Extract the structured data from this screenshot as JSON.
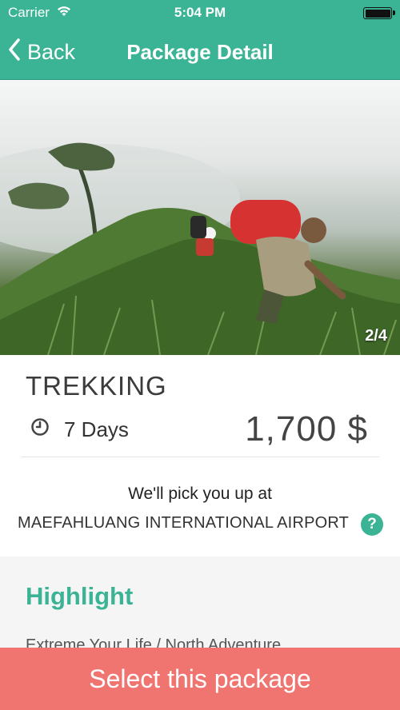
{
  "status_bar": {
    "carrier": "Carrier",
    "time": "5:04 PM"
  },
  "nav": {
    "back_label": "Back",
    "title": "Package Detail"
  },
  "hero": {
    "page_indicator": "2/4"
  },
  "package": {
    "name": "TREKKING",
    "duration": "7 Days",
    "price": "1,700 $",
    "pickup_label": "We'll pick you up at",
    "pickup_location": "MAEFAHLUANG INTERNATIONAL AIRPORT",
    "help_symbol": "?"
  },
  "highlight": {
    "title": "Highlight",
    "text": "Extreme Your Life / North Adventure"
  },
  "cta": {
    "label": "Select this package"
  },
  "colors": {
    "primary": "#3bb395",
    "cta": "#f07570"
  }
}
